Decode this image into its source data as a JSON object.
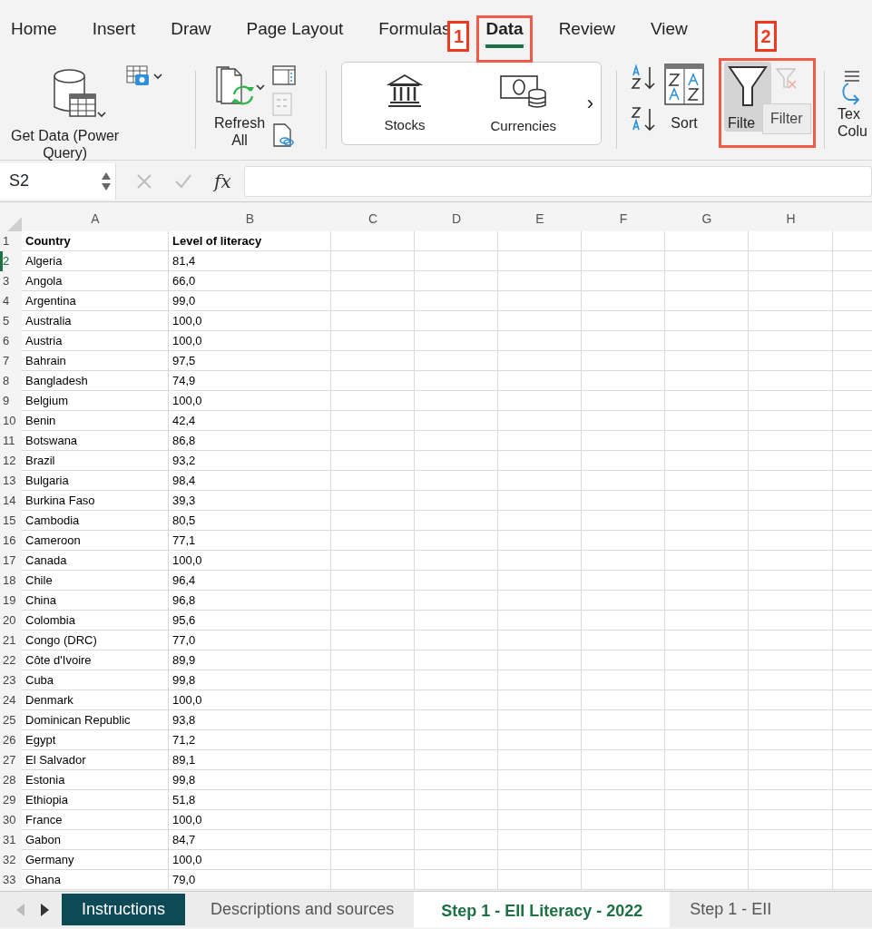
{
  "ribbon_tabs": [
    {
      "label": "Home",
      "selected": false
    },
    {
      "label": "Insert",
      "selected": false
    },
    {
      "label": "Draw",
      "selected": false
    },
    {
      "label": "Page Layout",
      "selected": false
    },
    {
      "label": "Formulas",
      "selected": false
    },
    {
      "label": "Data",
      "selected": true
    },
    {
      "label": "Review",
      "selected": false
    },
    {
      "label": "View",
      "selected": false
    }
  ],
  "annotations": [
    {
      "label": "1"
    },
    {
      "label": "2"
    }
  ],
  "ribbon": {
    "get_data": {
      "lines": [
        "Get Data (Power",
        "Query)"
      ]
    },
    "refresh": {
      "lines": [
        "Refresh",
        "All"
      ]
    },
    "data_types": [
      {
        "label": "Stocks",
        "kind": "bank"
      },
      {
        "label": "Currencies",
        "kind": "money"
      }
    ],
    "data_types_next": "›",
    "sort": {
      "label": "Sort"
    },
    "filter": {
      "label": "Filte",
      "selected": true
    },
    "clear_filter": {
      "disabled": true
    },
    "text_to_columns": {
      "lines": [
        "Tex",
        "Colu"
      ]
    }
  },
  "tooltip": "Filter",
  "formula_bar": {
    "name_box": "S2",
    "fx": "fx"
  },
  "sheet": {
    "columns": [
      "A",
      "B",
      "C",
      "D",
      "E",
      "F",
      "G",
      "H"
    ],
    "header": {
      "number": "1",
      "cells": [
        "Country",
        "Level of literacy"
      ]
    },
    "rows": [
      {
        "number": "2",
        "selected": true,
        "cells": [
          "Algeria",
          "81,4"
        ]
      },
      {
        "number": "3",
        "selected": false,
        "cells": [
          "Angola",
          "66,0"
        ]
      },
      {
        "number": "4",
        "selected": false,
        "cells": [
          "Argentina",
          "99,0"
        ]
      },
      {
        "number": "5",
        "selected": false,
        "cells": [
          "Australia",
          "100,0"
        ]
      },
      {
        "number": "6",
        "selected": false,
        "cells": [
          "Austria",
          "100,0"
        ]
      },
      {
        "number": "7",
        "selected": false,
        "cells": [
          "Bahrain",
          "97,5"
        ]
      },
      {
        "number": "8",
        "selected": false,
        "cells": [
          "Bangladesh",
          "74,9"
        ]
      },
      {
        "number": "9",
        "selected": false,
        "cells": [
          "Belgium",
          "100,0"
        ]
      },
      {
        "number": "10",
        "selected": false,
        "cells": [
          "Benin",
          "42,4"
        ]
      },
      {
        "number": "11",
        "selected": false,
        "cells": [
          "Botswana",
          "86,8"
        ]
      },
      {
        "number": "12",
        "selected": false,
        "cells": [
          "Brazil",
          "93,2"
        ]
      },
      {
        "number": "13",
        "selected": false,
        "cells": [
          "Bulgaria",
          "98,4"
        ]
      },
      {
        "number": "14",
        "selected": false,
        "cells": [
          "Burkina Faso",
          "39,3"
        ]
      },
      {
        "number": "15",
        "selected": false,
        "cells": [
          "Cambodia",
          "80,5"
        ]
      },
      {
        "number": "16",
        "selected": false,
        "cells": [
          "Cameroon",
          "77,1"
        ]
      },
      {
        "number": "17",
        "selected": false,
        "cells": [
          "Canada",
          "100,0"
        ]
      },
      {
        "number": "18",
        "selected": false,
        "cells": [
          "Chile",
          "96,4"
        ]
      },
      {
        "number": "19",
        "selected": false,
        "cells": [
          "China",
          "96,8"
        ]
      },
      {
        "number": "20",
        "selected": false,
        "cells": [
          "Colombia",
          "95,6"
        ]
      },
      {
        "number": "21",
        "selected": false,
        "cells": [
          "Congo (DRC)",
          "77,0"
        ]
      },
      {
        "number": "22",
        "selected": false,
        "cells": [
          "Côte d'Ivoire",
          "89,9"
        ]
      },
      {
        "number": "23",
        "selected": false,
        "cells": [
          "Cuba",
          "99,8"
        ]
      },
      {
        "number": "24",
        "selected": false,
        "cells": [
          "Denmark",
          "100,0"
        ]
      },
      {
        "number": "25",
        "selected": false,
        "cells": [
          "Dominican Republic",
          "93,8"
        ]
      },
      {
        "number": "26",
        "selected": false,
        "cells": [
          "Egypt",
          "71,2"
        ]
      },
      {
        "number": "27",
        "selected": false,
        "cells": [
          "El Salvador",
          "89,1"
        ]
      },
      {
        "number": "28",
        "selected": false,
        "cells": [
          "Estonia",
          "99,8"
        ]
      },
      {
        "number": "29",
        "selected": false,
        "cells": [
          "Ethiopia",
          "51,8"
        ]
      },
      {
        "number": "30",
        "selected": false,
        "cells": [
          "France",
          "100,0"
        ]
      },
      {
        "number": "31",
        "selected": false,
        "cells": [
          "Gabon",
          "84,7"
        ]
      },
      {
        "number": "32",
        "selected": false,
        "cells": [
          "Germany",
          "100,0"
        ]
      },
      {
        "number": "33",
        "selected": false,
        "cells": [
          "Ghana",
          "79,0"
        ]
      }
    ]
  },
  "sheet_tabs": [
    {
      "label": "Instructions",
      "selected": false,
      "color": "#0e4a56"
    },
    {
      "label": "Descriptions and sources",
      "selected": false
    },
    {
      "label": "Step 1 - EII Literacy - 2022",
      "selected": true
    },
    {
      "label": "Step 1 - EII",
      "selected": false
    }
  ]
}
